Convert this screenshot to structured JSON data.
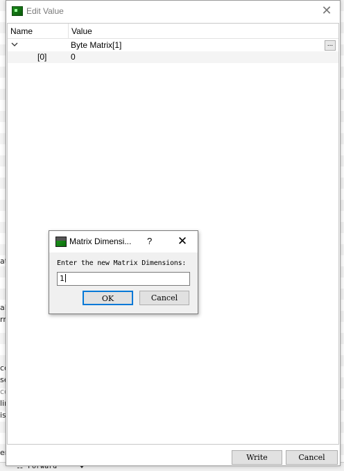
{
  "background": {
    "left_text_fragments": [
      "at",
      "al",
      "rr",
      "cc",
      "se",
      "cc",
      "lin",
      "is",
      "er"
    ],
    "bottombar": {
      "icon": "network-icon",
      "label": "Forward"
    }
  },
  "window": {
    "title": "Edit Value",
    "icon": "app-icon",
    "close_icon": "close-icon",
    "tree": {
      "columns": [
        "Name",
        "Value"
      ],
      "rows": [
        {
          "name": "",
          "value": "Byte Matrix[1]",
          "expanded": true,
          "ellipsis": "..."
        },
        {
          "name": "[0]",
          "value": "0"
        }
      ]
    },
    "buttons": {
      "write": "Write",
      "cancel": "Cancel"
    }
  },
  "dialog": {
    "title": "Matrix Dimensi...",
    "help": "?",
    "prompt": "Enter the new Matrix Dimensions:",
    "input_value": "1",
    "ok": "OK",
    "cancel": "Cancel"
  },
  "colors": {
    "focus_border": "#0078d7",
    "button_face": "#e1e1e1",
    "dialog_bg": "#f0f0f0"
  }
}
